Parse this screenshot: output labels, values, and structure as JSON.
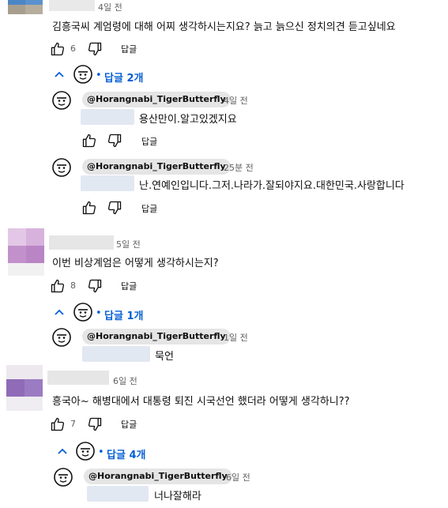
{
  "colors": {
    "accent": "#065fd4",
    "handle_bg": "#e5e5e5",
    "muted": "#606060"
  },
  "comments": [
    {
      "time": "4일 전",
      "text": "김흥국씨 계엄령에 대해 어찌 생각하시는지요? 늙고 늙으신 정치의견 듣고싶네요",
      "likes": "6",
      "reply_label": "답글",
      "replies_toggle": "답글 2개",
      "replies": [
        {
          "handle": "@Horangnabi_TigerButterfly",
          "time": "4일 전",
          "text": "용산만이.알고있겠지요",
          "reply_label": "답글"
        },
        {
          "handle": "@Horangnabi_TigerButterfly",
          "time": "25분 전",
          "text": "난.연예인입니다.그저.나라가.잘되야지요.대한민국.사랑합니다",
          "reply_label": "답글"
        }
      ]
    },
    {
      "time": "5일 전",
      "text": "이번 비상계엄은 어떻게 생각하시는지?",
      "likes": "8",
      "reply_label": "답글",
      "replies_toggle": "답글 1개",
      "replies": [
        {
          "handle": "@Horangnabi_TigerButterfly",
          "time": "1일 전",
          "text": "묵언"
        }
      ]
    },
    {
      "time": "6일 전",
      "text": "흥국아~ 해병대에서 대통령 퇴진 시국선언 했더라 어떻게 생각하니??",
      "likes": "7",
      "reply_label": "답글",
      "replies_toggle": "답글 4개",
      "replies": [
        {
          "handle": "@Horangnabi_TigerButterfly",
          "time": "6일 전",
          "text": "너나잘해라"
        }
      ]
    }
  ]
}
